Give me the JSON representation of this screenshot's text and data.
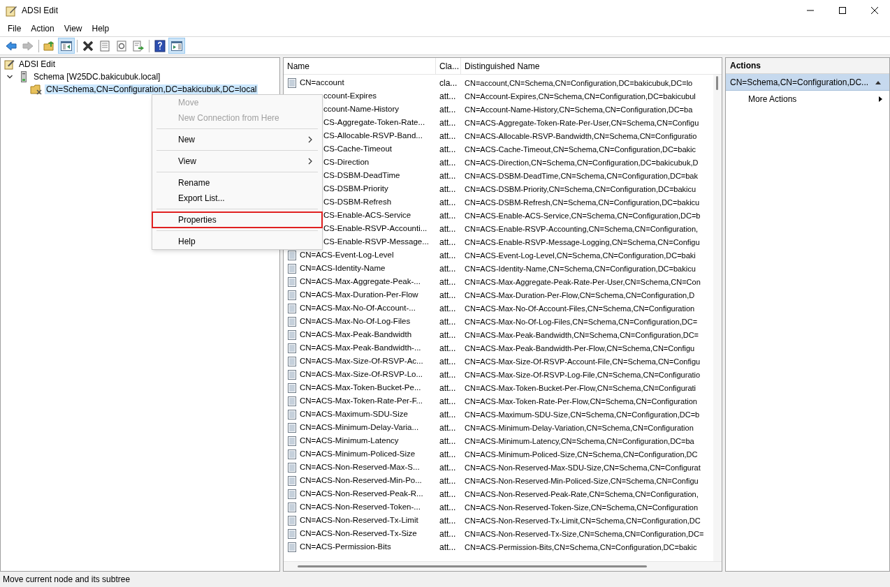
{
  "window": {
    "title": "ADSI Edit"
  },
  "menu_bar": [
    "File",
    "Action",
    "View",
    "Help"
  ],
  "toolbar": [
    {
      "kind": "back",
      "disabled": false,
      "pressed": false
    },
    {
      "kind": "forward",
      "disabled": true,
      "pressed": false
    },
    {
      "kind": "separator"
    },
    {
      "kind": "up",
      "disabled": false,
      "pressed": false
    },
    {
      "kind": "tree",
      "disabled": false,
      "pressed": true
    },
    {
      "kind": "separator"
    },
    {
      "kind": "delete",
      "disabled": false,
      "pressed": false
    },
    {
      "kind": "properties",
      "disabled": false,
      "pressed": false
    },
    {
      "kind": "refresh",
      "disabled": false,
      "pressed": false
    },
    {
      "kind": "export",
      "disabled": false,
      "pressed": false
    },
    {
      "kind": "separator"
    },
    {
      "kind": "help",
      "disabled": false,
      "pressed": false
    },
    {
      "kind": "actionpane",
      "disabled": false,
      "pressed": true
    }
  ],
  "tree": {
    "label": "ADSI Edit",
    "children": [
      {
        "label": "Schema [W25DC.bakicubuk.local]",
        "expanded": true,
        "selected": false,
        "children": [
          {
            "label": "CN=Schema,CN=Configuration,DC=bakicubuk,DC=local",
            "selected": true
          }
        ]
      }
    ]
  },
  "context_menu": [
    {
      "label": "Move",
      "disabled": true,
      "submenu": false,
      "highlighted": false
    },
    {
      "label": "New Connection from Here",
      "disabled": true,
      "submenu": false,
      "highlighted": false
    },
    {
      "kind": "separator"
    },
    {
      "label": "New",
      "disabled": false,
      "submenu": true,
      "highlighted": false
    },
    {
      "kind": "separator"
    },
    {
      "label": "View",
      "disabled": false,
      "submenu": true,
      "highlighted": false
    },
    {
      "kind": "separator"
    },
    {
      "label": "Rename",
      "disabled": false,
      "submenu": false,
      "highlighted": false
    },
    {
      "label": "Export List...",
      "disabled": false,
      "submenu": false,
      "highlighted": false
    },
    {
      "kind": "separator"
    },
    {
      "label": "Properties",
      "disabled": false,
      "submenu": false,
      "highlighted": true
    },
    {
      "kind": "separator"
    },
    {
      "label": "Help",
      "disabled": false,
      "submenu": false,
      "highlighted": false
    }
  ],
  "table": {
    "columns": [
      "Name",
      "Cla...",
      "Distinguished Name"
    ],
    "rows": [
      {
        "covered": false,
        "name": "CN=account",
        "class": "cla...",
        "dn": "CN=account,CN=Schema,CN=Configuration,DC=bakicubuk,DC=lo"
      },
      {
        "covered": true,
        "name": "ccount-Expires",
        "class": "att...",
        "dn": "CN=Account-Expires,CN=Schema,CN=Configuration,DC=bakicubul"
      },
      {
        "covered": true,
        "name": "ccount-Name-History",
        "class": "att...",
        "dn": "CN=Account-Name-History,CN=Schema,CN=Configuration,DC=ba"
      },
      {
        "covered": true,
        "name": "CS-Aggregate-Token-Rate...",
        "class": "att...",
        "dn": "CN=ACS-Aggregate-Token-Rate-Per-User,CN=Schema,CN=Configu"
      },
      {
        "covered": true,
        "name": "CS-Allocable-RSVP-Band...",
        "class": "att...",
        "dn": "CN=ACS-Allocable-RSVP-Bandwidth,CN=Schema,CN=Configuratio"
      },
      {
        "covered": true,
        "name": "CS-Cache-Timeout",
        "class": "att...",
        "dn": "CN=ACS-Cache-Timeout,CN=Schema,CN=Configuration,DC=bakic"
      },
      {
        "covered": true,
        "name": "CS-Direction",
        "class": "att...",
        "dn": "CN=ACS-Direction,CN=Schema,CN=Configuration,DC=bakicubuk,D"
      },
      {
        "covered": true,
        "name": "CS-DSBM-DeadTime",
        "class": "att...",
        "dn": "CN=ACS-DSBM-DeadTime,CN=Schema,CN=Configuration,DC=bak"
      },
      {
        "covered": true,
        "name": "CS-DSBM-Priority",
        "class": "att...",
        "dn": "CN=ACS-DSBM-Priority,CN=Schema,CN=Configuration,DC=bakicu"
      },
      {
        "covered": true,
        "name": "CS-DSBM-Refresh",
        "class": "att...",
        "dn": "CN=ACS-DSBM-Refresh,CN=Schema,CN=Configuration,DC=bakicu"
      },
      {
        "covered": true,
        "name": "CS-Enable-ACS-Service",
        "class": "att...",
        "dn": "CN=ACS-Enable-ACS-Service,CN=Schema,CN=Configuration,DC=b"
      },
      {
        "covered": true,
        "name": "CS-Enable-RSVP-Accounti...",
        "class": "att...",
        "dn": "CN=ACS-Enable-RSVP-Accounting,CN=Schema,CN=Configuration,"
      },
      {
        "covered": true,
        "name": "CS-Enable-RSVP-Message...",
        "class": "att...",
        "dn": "CN=ACS-Enable-RSVP-Message-Logging,CN=Schema,CN=Configu"
      },
      {
        "covered": false,
        "name": "CN=ACS-Event-Log-Level",
        "class": "att...",
        "dn": "CN=ACS-Event-Log-Level,CN=Schema,CN=Configuration,DC=baki"
      },
      {
        "covered": false,
        "name": "CN=ACS-Identity-Name",
        "class": "att...",
        "dn": "CN=ACS-Identity-Name,CN=Schema,CN=Configuration,DC=bakicu"
      },
      {
        "covered": false,
        "name": "CN=ACS-Max-Aggregate-Peak-...",
        "class": "att...",
        "dn": "CN=ACS-Max-Aggregate-Peak-Rate-Per-User,CN=Schema,CN=Con"
      },
      {
        "covered": false,
        "name": "CN=ACS-Max-Duration-Per-Flow",
        "class": "att...",
        "dn": "CN=ACS-Max-Duration-Per-Flow,CN=Schema,CN=Configuration,D"
      },
      {
        "covered": false,
        "name": "CN=ACS-Max-No-Of-Account-...",
        "class": "att...",
        "dn": "CN=ACS-Max-No-Of-Account-Files,CN=Schema,CN=Configuration"
      },
      {
        "covered": false,
        "name": "CN=ACS-Max-No-Of-Log-Files",
        "class": "att...",
        "dn": "CN=ACS-Max-No-Of-Log-Files,CN=Schema,CN=Configuration,DC="
      },
      {
        "covered": false,
        "name": "CN=ACS-Max-Peak-Bandwidth",
        "class": "att...",
        "dn": "CN=ACS-Max-Peak-Bandwidth,CN=Schema,CN=Configuration,DC="
      },
      {
        "covered": false,
        "name": "CN=ACS-Max-Peak-Bandwidth-...",
        "class": "att...",
        "dn": "CN=ACS-Max-Peak-Bandwidth-Per-Flow,CN=Schema,CN=Configu"
      },
      {
        "covered": false,
        "name": "CN=ACS-Max-Size-Of-RSVP-Ac...",
        "class": "att...",
        "dn": "CN=ACS-Max-Size-Of-RSVP-Account-File,CN=Schema,CN=Configu"
      },
      {
        "covered": false,
        "name": "CN=ACS-Max-Size-Of-RSVP-Lo...",
        "class": "att...",
        "dn": "CN=ACS-Max-Size-Of-RSVP-Log-File,CN=Schema,CN=Configuratio"
      },
      {
        "covered": false,
        "name": "CN=ACS-Max-Token-Bucket-Pe...",
        "class": "att...",
        "dn": "CN=ACS-Max-Token-Bucket-Per-Flow,CN=Schema,CN=Configurati"
      },
      {
        "covered": false,
        "name": "CN=ACS-Max-Token-Rate-Per-F...",
        "class": "att...",
        "dn": "CN=ACS-Max-Token-Rate-Per-Flow,CN=Schema,CN=Configuration"
      },
      {
        "covered": false,
        "name": "CN=ACS-Maximum-SDU-Size",
        "class": "att...",
        "dn": "CN=ACS-Maximum-SDU-Size,CN=Schema,CN=Configuration,DC=b"
      },
      {
        "covered": false,
        "name": "CN=ACS-Minimum-Delay-Varia...",
        "class": "att...",
        "dn": "CN=ACS-Minimum-Delay-Variation,CN=Schema,CN=Configuration"
      },
      {
        "covered": false,
        "name": "CN=ACS-Minimum-Latency",
        "class": "att...",
        "dn": "CN=ACS-Minimum-Latency,CN=Schema,CN=Configuration,DC=ba"
      },
      {
        "covered": false,
        "name": "CN=ACS-Minimum-Policed-Size",
        "class": "att...",
        "dn": "CN=ACS-Minimum-Policed-Size,CN=Schema,CN=Configuration,DC"
      },
      {
        "covered": false,
        "name": "CN=ACS-Non-Reserved-Max-S...",
        "class": "att...",
        "dn": "CN=ACS-Non-Reserved-Max-SDU-Size,CN=Schema,CN=Configurat"
      },
      {
        "covered": false,
        "name": "CN=ACS-Non-Reserved-Min-Po...",
        "class": "att...",
        "dn": "CN=ACS-Non-Reserved-Min-Policed-Size,CN=Schema,CN=Configu"
      },
      {
        "covered": false,
        "name": "CN=ACS-Non-Reserved-Peak-R...",
        "class": "att...",
        "dn": "CN=ACS-Non-Reserved-Peak-Rate,CN=Schema,CN=Configuration,"
      },
      {
        "covered": false,
        "name": "CN=ACS-Non-Reserved-Token-...",
        "class": "att...",
        "dn": "CN=ACS-Non-Reserved-Token-Size,CN=Schema,CN=Configuration"
      },
      {
        "covered": false,
        "name": "CN=ACS-Non-Reserved-Tx-Limit",
        "class": "att...",
        "dn": "CN=ACS-Non-Reserved-Tx-Limit,CN=Schema,CN=Configuration,DC"
      },
      {
        "covered": false,
        "name": "CN=ACS-Non-Reserved-Tx-Size",
        "class": "att...",
        "dn": "CN=ACS-Non-Reserved-Tx-Size,CN=Schema,CN=Configuration,DC="
      },
      {
        "covered": false,
        "name": "CN=ACS-Permission-Bits",
        "class": "att...",
        "dn": "CN=ACS-Permission-Bits,CN=Schema,CN=Configuration,DC=bakic"
      }
    ]
  },
  "actions": {
    "title": "Actions",
    "sections": [
      {
        "label": "CN=Schema,CN=Configuration,DC...",
        "expanded": true,
        "items": [
          {
            "label": "More Actions",
            "submenu": true
          }
        ]
      }
    ]
  },
  "status_bar": "Move current node and its subtree"
}
